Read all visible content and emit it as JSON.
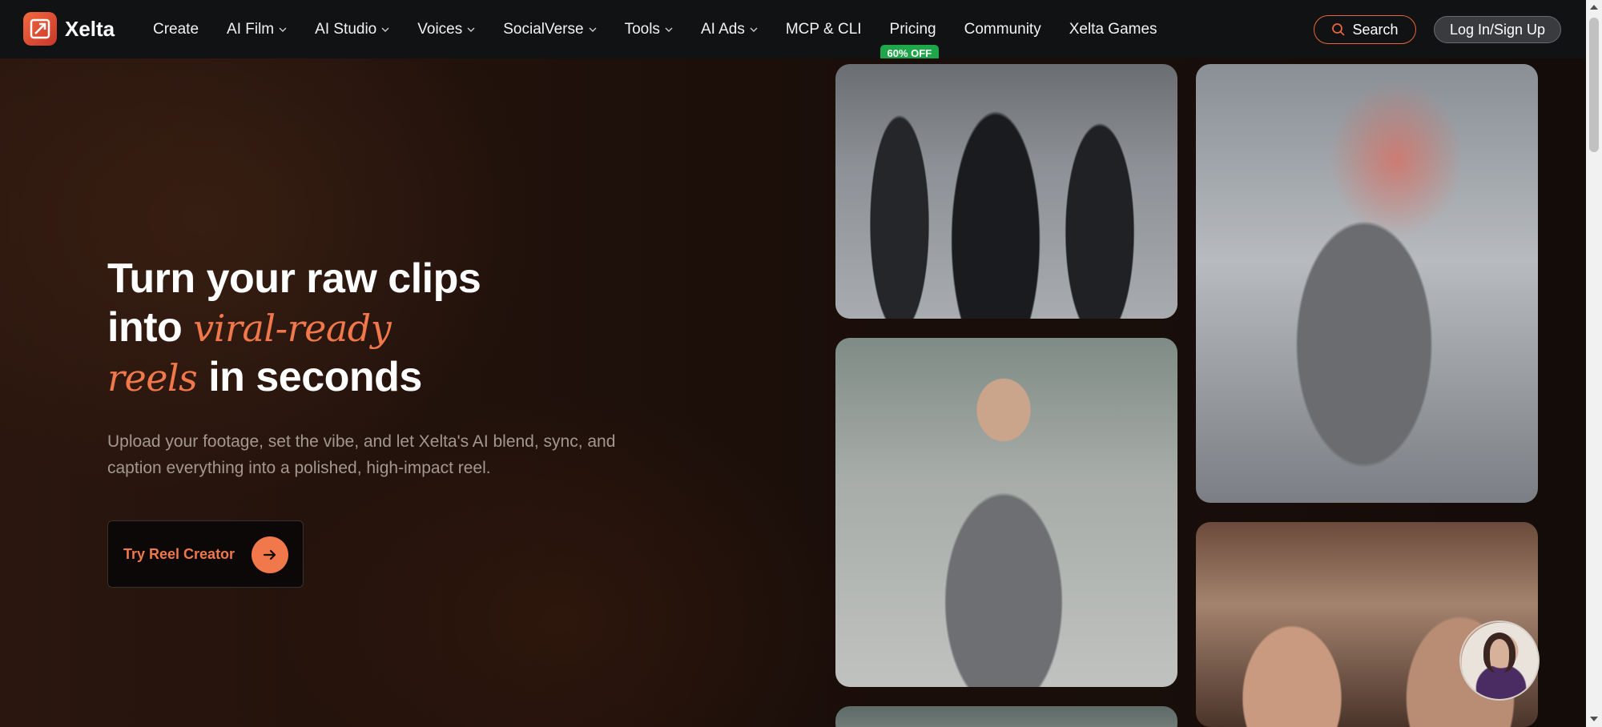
{
  "brand": {
    "name": "Xelta",
    "accent": "#f0784a"
  },
  "nav": {
    "items": [
      {
        "label": "Create",
        "dropdown": false
      },
      {
        "label": "AI Film",
        "dropdown": true
      },
      {
        "label": "AI Studio",
        "dropdown": true
      },
      {
        "label": "Voices",
        "dropdown": true
      },
      {
        "label": "SocialVerse",
        "dropdown": true
      },
      {
        "label": "Tools",
        "dropdown": true
      },
      {
        "label": "AI Ads",
        "dropdown": true
      },
      {
        "label": "MCP & CLI",
        "dropdown": false
      },
      {
        "label": "Pricing",
        "dropdown": false
      },
      {
        "label": "Community",
        "dropdown": false
      },
      {
        "label": "Xelta Games",
        "dropdown": false
      }
    ],
    "pricing_badge": "60% OFF",
    "search_label": "Search",
    "login_label": "Log In/Sign Up"
  },
  "hero": {
    "title_line1": "Turn your raw clips",
    "title_into": "into",
    "title_accent1": "viral-ready",
    "title_accent2": "reels",
    "title_end": "in seconds",
    "subtitle": "Upload your footage, set the vibe, and let Xelta's AI blend, sync, and caption everything into a polished, high-impact reel.",
    "cta_label": "Try Reel Creator"
  }
}
